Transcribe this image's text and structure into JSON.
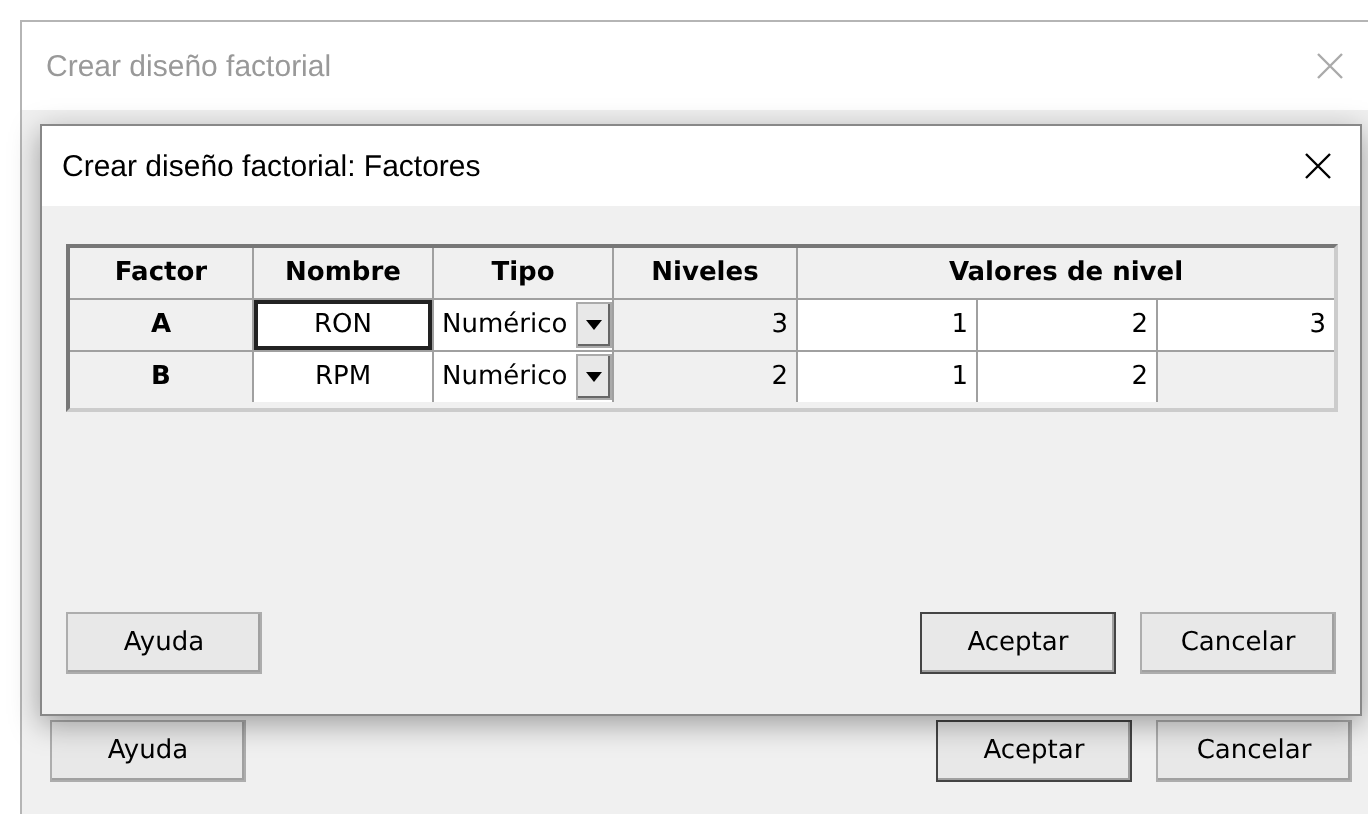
{
  "window": {
    "title": "Crear diseño factorial",
    "buttons": [
      "Ayuda",
      "Aceptar",
      "Cancelar"
    ]
  },
  "dialog": {
    "title": "Crear diseño factorial: Factores",
    "table": {
      "columns": [
        "Factor",
        "Nombre",
        "Tipo",
        "Niveles",
        "Valores de nivel"
      ],
      "rows": [
        {
          "factor": "A",
          "name": "RON",
          "selected": true,
          "type": "Numérico",
          "levels": "3",
          "values": [
            "1",
            "2",
            "3"
          ]
        },
        {
          "factor": "B",
          "name": "RPM",
          "selected": false,
          "type": "Numérico",
          "levels": "2",
          "values": [
            "1",
            "2"
          ]
        }
      ]
    },
    "buttons": [
      "Ayuda",
      "Aceptar",
      "Cancelar"
    ]
  }
}
